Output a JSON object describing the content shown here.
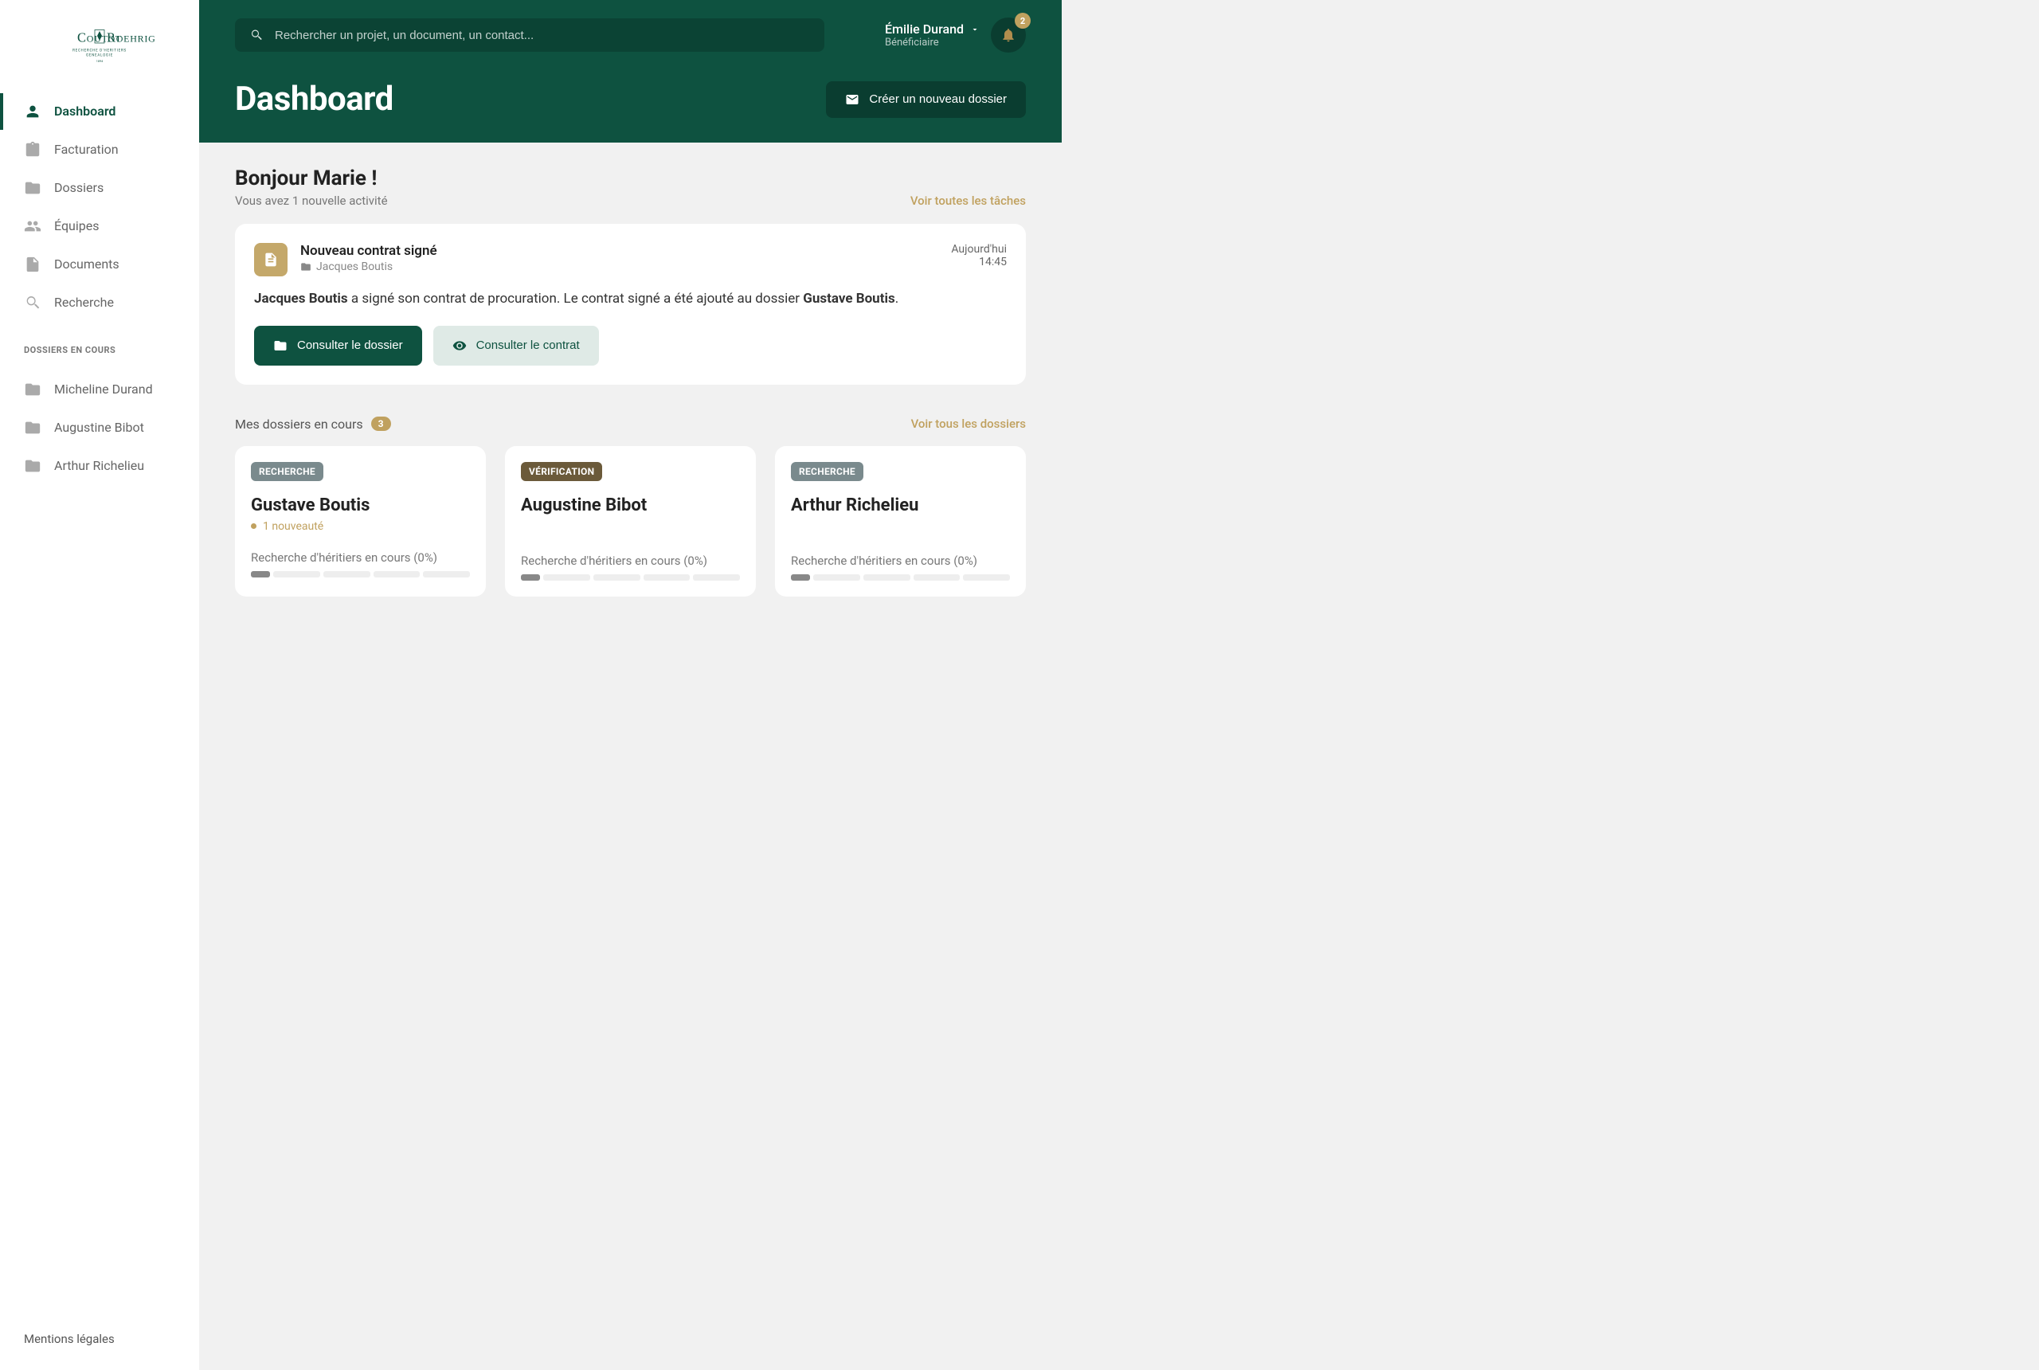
{
  "brand": {
    "name": "Coutot Roehrig",
    "subtitle1": "RECHERCHE D'HERITIERS",
    "subtitle2": "GENEALOGIE"
  },
  "search": {
    "placeholder": "Rechercher un projet, un document, un contact..."
  },
  "user": {
    "name": "Émilie Durand",
    "role": "Bénéficiaire",
    "notifications": "2"
  },
  "page": {
    "title": "Dashboard",
    "create_btn": "Créer un nouveau dossier"
  },
  "nav": {
    "items": [
      {
        "label": "Dashboard"
      },
      {
        "label": "Facturation"
      },
      {
        "label": "Dossiers"
      },
      {
        "label": "Équipes"
      },
      {
        "label": "Documents"
      },
      {
        "label": "Recherche"
      }
    ],
    "section_label": "DOSSIERS EN COURS",
    "folders": [
      {
        "label": "Micheline Durand"
      },
      {
        "label": "Augustine Bibot"
      },
      {
        "label": "Arthur Richelieu"
      }
    ],
    "legal": "Mentions légales"
  },
  "greeting": {
    "title": "Bonjour Marie !",
    "subtitle": "Vous avez 1 nouvelle activité",
    "all_tasks": "Voir toutes les tâches"
  },
  "activity": {
    "title": "Nouveau contrat signé",
    "folder": "Jacques Boutis",
    "date": "Aujourd'hui",
    "time": "14:45",
    "body_name1": "Jacques Boutis",
    "body_mid": " a signé son contrat de procuration. Le contrat signé a été ajouté au dossier ",
    "body_name2": "Gustave Boutis",
    "body_end": ".",
    "btn_folder": "Consulter le dossier",
    "btn_contract": "Consulter le contrat"
  },
  "dossiers": {
    "title": "Mes dossiers en cours",
    "count": "3",
    "all_link": "Voir tous les dossiers",
    "cards": [
      {
        "tag": "RECHERCHE",
        "tag_class": "recherche",
        "name": "Gustave Boutis",
        "new": "1 nouveauté",
        "progress": "Recherche d'héritiers en cours (0%)"
      },
      {
        "tag": "VÉRIFICATION",
        "tag_class": "verification",
        "name": "Augustine Bibot",
        "new": "",
        "progress": "Recherche d'héritiers en cours (0%)"
      },
      {
        "tag": "RECHERCHE",
        "tag_class": "recherche",
        "name": "Arthur Richelieu",
        "new": "",
        "progress": "Recherche d'héritiers en cours (0%)"
      }
    ]
  }
}
